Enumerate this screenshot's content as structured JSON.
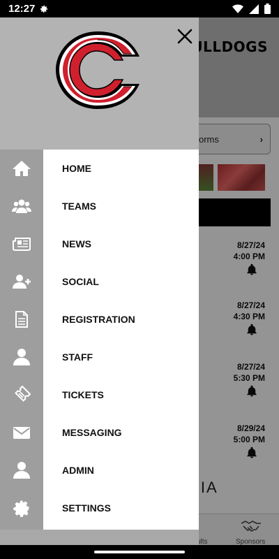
{
  "status_bar": {
    "time": "12:27"
  },
  "background": {
    "title": "BULLDOGS",
    "forms_label": "orms",
    "events": [
      {
        "date": "8/27/24",
        "time": "4:00 PM"
      },
      {
        "date": "8/27/24",
        "time": "4:30 PM"
      },
      {
        "date": "8/27/24",
        "time": "5:30 PM"
      },
      {
        "date": "8/29/24",
        "time": "5:00 PM"
      }
    ],
    "media_label": "DIA",
    "tabs": {
      "results": "ults",
      "sponsors": "Sponsors"
    }
  },
  "drawer": {
    "logo_icon": "c-logo",
    "logo_color": "#d0202e",
    "menu": [
      {
        "label": "HOME",
        "icon": "home-icon"
      },
      {
        "label": "TEAMS",
        "icon": "users-icon"
      },
      {
        "label": "NEWS",
        "icon": "newspaper-icon"
      },
      {
        "label": "SOCIAL",
        "icon": "add-user-icon"
      },
      {
        "label": "REGISTRATION",
        "icon": "document-icon"
      },
      {
        "label": "STAFF",
        "icon": "user-icon"
      },
      {
        "label": "TICKETS",
        "icon": "ticket-icon"
      },
      {
        "label": "MESSAGING",
        "icon": "envelope-icon"
      },
      {
        "label": "ADMIN",
        "icon": "user-icon"
      },
      {
        "label": "SETTINGS",
        "icon": "gear-icon"
      }
    ]
  }
}
